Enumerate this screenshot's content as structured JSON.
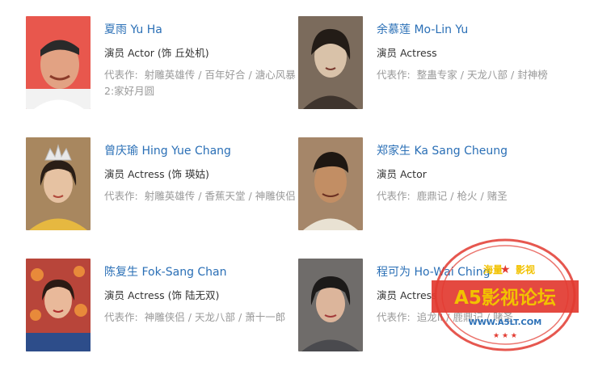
{
  "cast": [
    {
      "name": "夏雨 Yu Ha",
      "role": "演员 Actor (饰 丘处机)",
      "works_label": "代表作:",
      "works": [
        "射雕英雄传",
        "百年好合",
        "溏心风暴2:家好月圆"
      ],
      "photo_bg": "#e8584d"
    },
    {
      "name": "余慕莲 Mo-Lin Yu",
      "role": "演员 Actress",
      "works_label": "代表作:",
      "works": [
        "整蛊专家",
        "天龙八部",
        "封神榜"
      ],
      "photo_bg": "#7a6a5e"
    },
    {
      "name": "曾庆瑜 Hing Yue Chang",
      "role": "演员 Actress (饰 瑛姑)",
      "works_label": "代表作:",
      "works": [
        "射雕英雄传",
        "香蕉天堂",
        "神雕侠侣"
      ],
      "photo_bg": "#b0895a"
    },
    {
      "name": "郑家生 Ka Sang Cheung",
      "role": "演员 Actor",
      "works_label": "代表作:",
      "works": [
        "鹿鼎记",
        "枪火",
        "赌圣"
      ],
      "photo_bg": "#9c7e62"
    },
    {
      "name": "陈复生 Fok-Sang Chan",
      "role": "演员 Actress (饰 陆无双)",
      "works_label": "代表作:",
      "works": [
        "神雕侠侣",
        "天龙八部",
        "萧十一郎"
      ],
      "photo_bg": "#c2483a"
    },
    {
      "name": "程可为 Ho-Wai Ching",
      "role": "演员 Actress",
      "works_label": "代表作:",
      "works": [
        "追龙II",
        "鹿鼎记",
        "赌圣"
      ],
      "photo_bg": "#6f6c6a"
    }
  ],
  "watermark": {
    "top_left": "海量",
    "top_right": "影视",
    "main": "A5影视论坛",
    "url": "WWW.A5LT.COM",
    "color": "#e23a30",
    "accent": "#f2c200"
  }
}
